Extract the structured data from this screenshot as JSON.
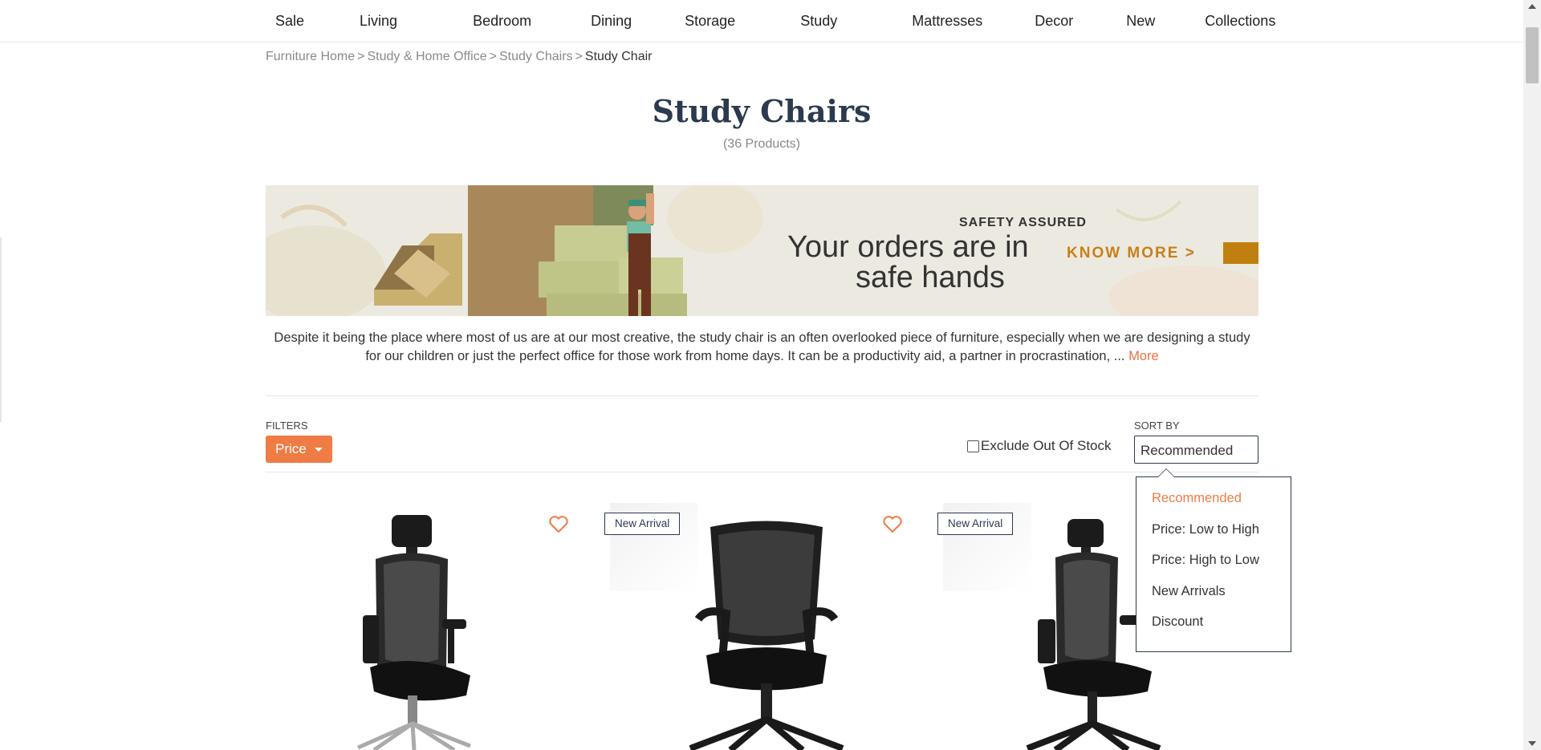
{
  "nav": {
    "items": [
      "Sale",
      "Living",
      "Bedroom",
      "Dining",
      "Storage",
      "Study",
      "Mattresses",
      "Decor",
      "New",
      "Collections"
    ]
  },
  "breadcrumb": {
    "items": [
      "Furniture Home",
      "Study & Home Office",
      "Study Chairs"
    ],
    "current": "Study Chair",
    "separator": ">"
  },
  "page": {
    "title": "Study Chairs",
    "count": "(36 Products)"
  },
  "banner": {
    "tag": "SAFETY ASSURED",
    "headline_line1": "Your orders are in",
    "headline_line2": "safe hands",
    "cta": "KNOW MORE >"
  },
  "description": {
    "text": "Despite it being the place where most of us are at our most creative, the study chair is an often overlooked piece of furniture, especially when we are designing a study for our children or just the perfect office for those work from home days. It can be a productivity aid, a partner in procrastination, ...",
    "more_label": "More"
  },
  "filters": {
    "label": "FILTERS",
    "price_label": "Price",
    "exclude_oos_label": "Exclude Out Of Stock",
    "exclude_oos_checked": false
  },
  "sort": {
    "label": "SORT BY",
    "selected": "Recommended",
    "options": [
      "Recommended",
      "Price: Low to High",
      "Price: High to Low",
      "New Arrivals",
      "Discount"
    ]
  },
  "products": [
    {
      "badge": "",
      "wishlist_icon": "heart-icon"
    },
    {
      "badge": "New Arrival",
      "wishlist_icon": "heart-icon"
    },
    {
      "badge": "New Arrival",
      "wishlist_icon": "heart-icon"
    }
  ],
  "colors": {
    "accent": "#ef7b45",
    "navy": "#2b3a4e",
    "banner_gold": "#c97e1a"
  }
}
